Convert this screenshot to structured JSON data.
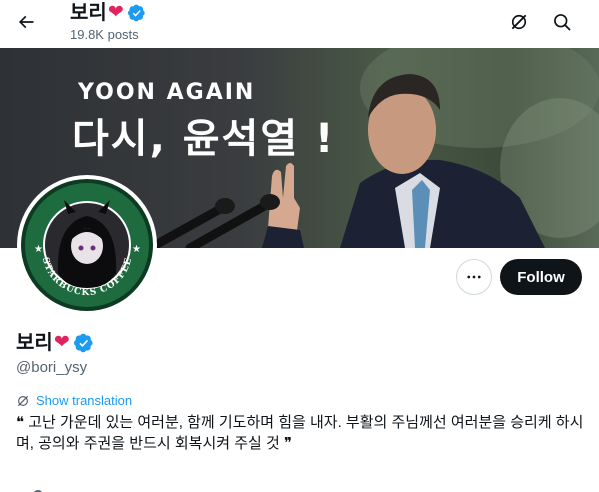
{
  "header": {
    "name": "보리",
    "heart": "❤",
    "posts": "19.8K posts"
  },
  "banner": {
    "line1": "YOON AGAIN",
    "line2": "다시, 윤석열 !"
  },
  "avatar": {
    "ring_text": "STARBUCKS COFFEE"
  },
  "actions": {
    "follow_label": "Follow"
  },
  "profile": {
    "name": "보리",
    "heart": "❤",
    "handle": "@bori_ysy",
    "translate_label": "Show translation",
    "bio": "❝ 고난 가운데 있는 여러분, 함께 기도하며 힘을 내자. 부활의 주님께선 여러분을 승리케 하시며, 공의와 주권을 반드시 회복시켜 주실 것 ❞"
  },
  "colors": {
    "accent": "#1d9bf0",
    "heart": "#e0245e",
    "starbucks_green": "#1e6b3f"
  }
}
